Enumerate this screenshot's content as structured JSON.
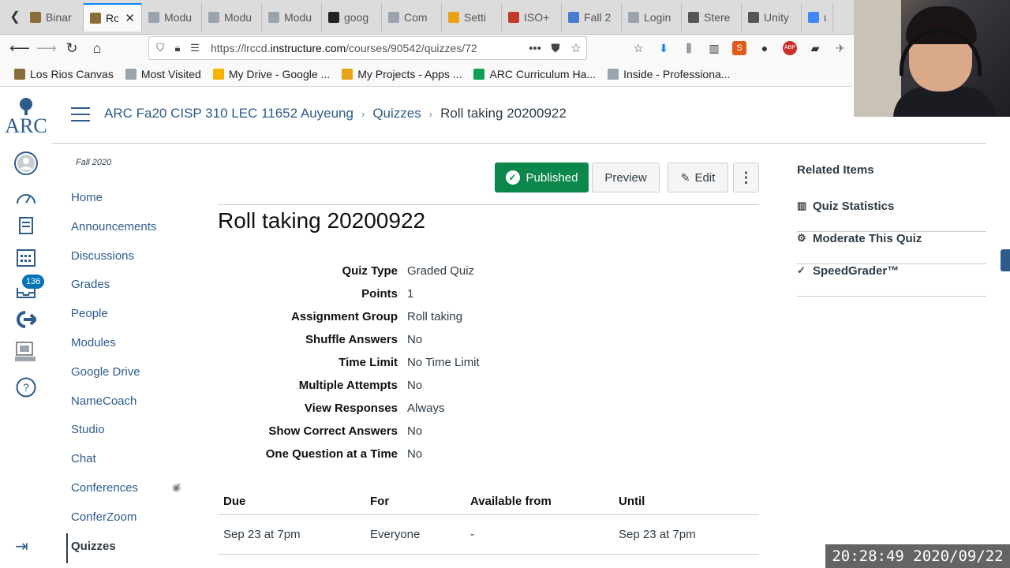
{
  "browser": {
    "tabs": [
      {
        "label": "Binar",
        "icon_color": "#8a6d3b",
        "active": false
      },
      {
        "label": "Ro",
        "icon_color": "#8a6d3b",
        "active": true
      },
      {
        "label": "Modu",
        "icon_color": "#9aa4ad",
        "active": false
      },
      {
        "label": "Modu",
        "icon_color": "#9aa4ad",
        "active": false
      },
      {
        "label": "Modu",
        "icon_color": "#9aa4ad",
        "active": false
      },
      {
        "label": "goog",
        "icon_color": "#222222",
        "active": false
      },
      {
        "label": "Com",
        "icon_color": "#9aa4ad",
        "active": false
      },
      {
        "label": "Setti",
        "icon_color": "#e8a317",
        "active": false
      },
      {
        "label": "ISO+",
        "icon_color": "#c0392b",
        "active": false
      },
      {
        "label": "Fall 2",
        "icon_color": "#4a7bd0",
        "active": false
      },
      {
        "label": "Login",
        "icon_color": "#9aa4ad",
        "active": false
      },
      {
        "label": "Stere",
        "icon_color": "#555555",
        "active": false
      },
      {
        "label": "Unity",
        "icon_color": "#555555",
        "active": false
      },
      {
        "label": "u",
        "icon_color": "#4285f4",
        "active": false
      }
    ],
    "url_prefix": "https://lrccd.",
    "url_domain": "instructure.com",
    "url_suffix": "/courses/90542/quizzes/72",
    "bookmarks": [
      {
        "label": "Los Rios Canvas",
        "icon_color": "#8a6d3b"
      },
      {
        "label": "Most Visited",
        "icon_color": "#9aa4ad"
      },
      {
        "label": "My Drive - Google ...",
        "icon_color": "#f4b400"
      },
      {
        "label": "My Projects - Apps ...",
        "icon_color": "#e8a317"
      },
      {
        "label": "ARC Curriculum Ha...",
        "icon_color": "#0f9d58"
      },
      {
        "label": "Inside - Professiona...",
        "icon_color": "#9aa4ad"
      }
    ]
  },
  "breadcrumb": {
    "course": "ARC Fa20 CISP 310 LEC 11652 Auyeung",
    "section": "Quizzes",
    "current": "Roll taking 20200922"
  },
  "global_nav": {
    "inbox_badge": "136"
  },
  "course_nav": {
    "term": "Fall 2020",
    "items": [
      "Home",
      "Announcements",
      "Discussions",
      "Grades",
      "People",
      "Modules",
      "Google Drive",
      "NameCoach",
      "Studio",
      "Chat",
      "Conferences",
      "ConferZoom",
      "Quizzes"
    ]
  },
  "toolbar": {
    "published_label": "Published",
    "preview_label": "Preview",
    "edit_label": "Edit",
    "more_label": "⋮"
  },
  "quiz": {
    "title": "Roll taking 20200922",
    "details": [
      {
        "key": "Quiz Type",
        "value": "Graded Quiz"
      },
      {
        "key": "Points",
        "value": "1"
      },
      {
        "key": "Assignment Group",
        "value": "Roll taking"
      },
      {
        "key": "Shuffle Answers",
        "value": "No"
      },
      {
        "key": "Time Limit",
        "value": "No Time Limit"
      },
      {
        "key": "Multiple Attempts",
        "value": "No"
      },
      {
        "key": "View Responses",
        "value": "Always"
      },
      {
        "key": "Show Correct Answers",
        "value": "No"
      },
      {
        "key": "One Question at a Time",
        "value": "No"
      }
    ],
    "due_headers": [
      "Due",
      "For",
      "Available from",
      "Until"
    ],
    "due_row": [
      "Sep 23 at 7pm",
      "Everyone",
      "-",
      "Sep 23 at 7pm"
    ]
  },
  "related": {
    "heading": "Related Items",
    "items": [
      "Quiz Statistics",
      "Moderate This Quiz",
      "SpeedGrader™"
    ]
  },
  "timestamp": "20:28:49 2020/09/22"
}
